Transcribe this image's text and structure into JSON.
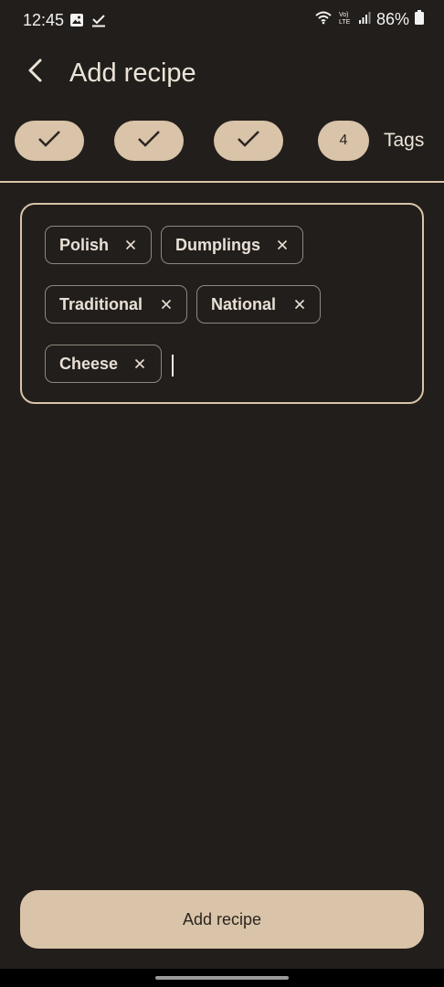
{
  "status_bar": {
    "time": "12:45",
    "battery": "86%",
    "left_icons": [
      "gallery-icon",
      "check-icon"
    ],
    "right_icons": [
      "wifi-icon",
      "volte-icon",
      "signal-icon",
      "battery-icon"
    ]
  },
  "app_bar": {
    "title": "Add recipe",
    "back_icon": "back-arrow-icon"
  },
  "stepper": {
    "completed_steps": 3,
    "current_step_number": "4",
    "current_step_label": "Tags"
  },
  "tags": {
    "items": [
      {
        "label": "Polish"
      },
      {
        "label": "Dumplings"
      },
      {
        "label": "Traditional"
      },
      {
        "label": "National"
      },
      {
        "label": "Cheese"
      }
    ]
  },
  "actions": {
    "submit_label": "Add recipe"
  },
  "colors": {
    "background": "#221e1b",
    "accent": "#d9c4a9",
    "text": "#ece4d8",
    "chip_border": "#8f8780"
  }
}
